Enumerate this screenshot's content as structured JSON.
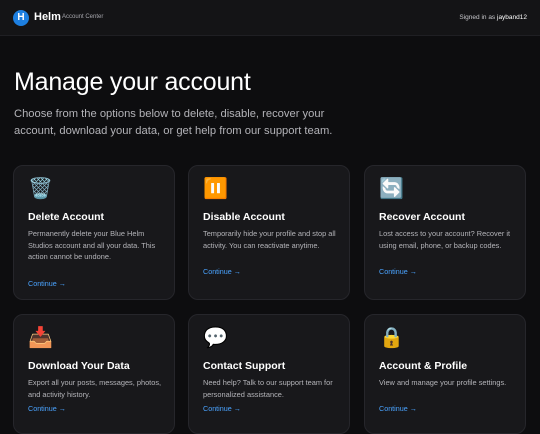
{
  "header": {
    "logo_letter": "H",
    "brand": "Helm",
    "brand_sub": "Account Center",
    "signed_in_prefix": "Signed in as",
    "username": "jayband12"
  },
  "page": {
    "title": "Manage your account",
    "subtitle": "Choose from the options below to delete, disable, recover your account, download your data, or get help from our support team."
  },
  "cards": [
    {
      "icon": "🗑️",
      "icon_name": "trash-icon",
      "title": "Delete Account",
      "description": "Permanently delete your Blue Helm Studios account and all your data. This action cannot be undone.",
      "link": "Continue →"
    },
    {
      "icon": "⏸️",
      "icon_name": "pause-icon",
      "title": "Disable Account",
      "description": "Temporarily hide your profile and stop all activity. You can reactivate anytime.",
      "link": "Continue →"
    },
    {
      "icon": "🔄",
      "icon_name": "refresh-icon",
      "title": "Recover Account",
      "description": "Lost access to your account? Recover it using email, phone, or backup codes.",
      "link": "Continue →"
    },
    {
      "icon": "📥",
      "icon_name": "download-tray-icon",
      "title": "Download Your Data",
      "description": "Export all your posts, messages, photos, and activity history.",
      "link": "Continue →"
    },
    {
      "icon": "💬",
      "icon_name": "speech-bubble-icon",
      "title": "Contact Support",
      "description": "Need help? Talk to our support team for personalized assistance.",
      "link": "Continue →"
    },
    {
      "icon": "🔒",
      "icon_name": "lock-icon",
      "title": "Account & Profile",
      "description": "View and manage your profile settings.",
      "link": "Continue →"
    }
  ]
}
